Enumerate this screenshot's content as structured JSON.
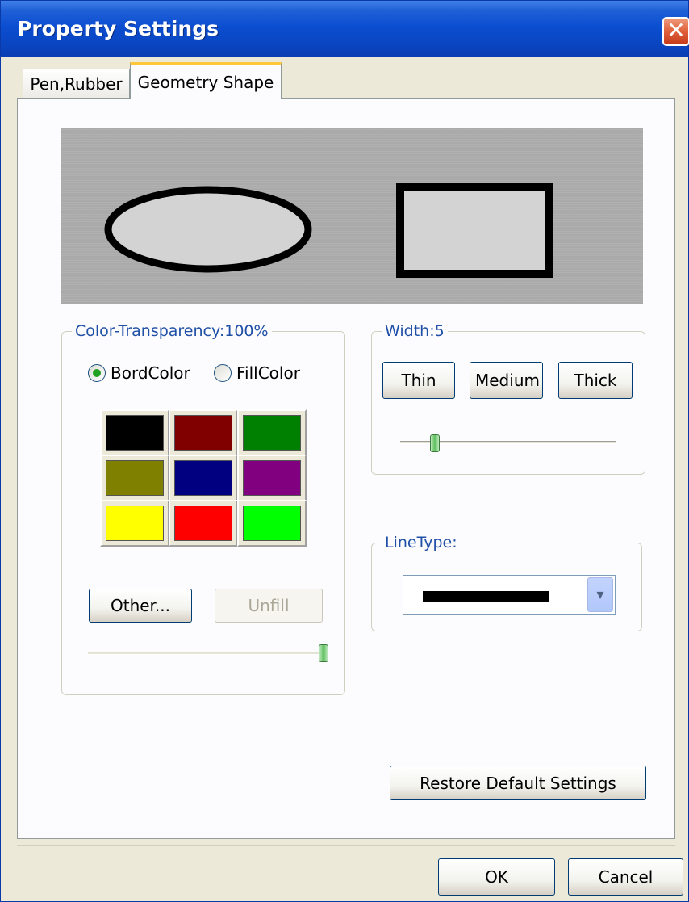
{
  "window": {
    "title": "Property Settings"
  },
  "tabs": [
    {
      "label": "Pen,Rubber",
      "selected": false
    },
    {
      "label": "Geometry Shape",
      "selected": true
    }
  ],
  "preview": {
    "background": "#aaaaaa",
    "shape_fill": "#d3d3d3",
    "border_color": "#000000"
  },
  "color_group": {
    "legend": "Color-Transparency:100%",
    "transparency_percent": 100,
    "radio_border": "BordColor",
    "radio_fill": "FillColor",
    "selected_target": "BordColor",
    "swatches": [
      "#000000",
      "#800000",
      "#008000",
      "#808000",
      "#000080",
      "#800080",
      "#ffff00",
      "#ff0000",
      "#00ff00"
    ],
    "other_label": "Other...",
    "unfill_label": "Unfill",
    "unfill_enabled": false
  },
  "width_group": {
    "legend": "Width:5",
    "width_value": 5,
    "thin_label": "Thin",
    "medium_label": "Medium",
    "thick_label": "Thick",
    "slider_fraction": 0.16
  },
  "linetype_group": {
    "legend": "LineType:",
    "selected": "solid"
  },
  "restore_label": "Restore Default Settings",
  "ok_label": "OK",
  "cancel_label": "Cancel"
}
